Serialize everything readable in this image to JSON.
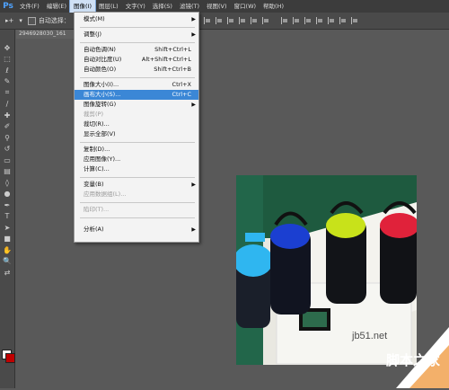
{
  "menubar": {
    "logo": "Ps",
    "items": [
      {
        "label": "文件(F)"
      },
      {
        "label": "编辑(E)"
      },
      {
        "label": "图像(I)"
      },
      {
        "label": "图层(L)"
      },
      {
        "label": "文字(Y)"
      },
      {
        "label": "选择(S)"
      },
      {
        "label": "滤镜(T)"
      },
      {
        "label": "视图(V)"
      },
      {
        "label": "窗口(W)"
      },
      {
        "label": "帮助(H)"
      }
    ],
    "active_index": 2
  },
  "optionsbar": {
    "auto_select_label": "自动选择："
  },
  "document": {
    "tab_title": "2946928030_161"
  },
  "image_menu": {
    "items": [
      {
        "label": "模式(M)",
        "shortcut": "",
        "submenu": true,
        "disabled": false
      },
      {
        "label": "调整(J)",
        "shortcut": "",
        "submenu": true,
        "disabled": false
      },
      {
        "label": "自动色调(N)",
        "shortcut": "Shift+Ctrl+L",
        "submenu": false,
        "disabled": false
      },
      {
        "label": "自动对比度(U)",
        "shortcut": "Alt+Shift+Ctrl+L",
        "submenu": false,
        "disabled": false
      },
      {
        "label": "自动颜色(O)",
        "shortcut": "Shift+Ctrl+B",
        "submenu": false,
        "disabled": false
      },
      {
        "label": "图像大小(I)...",
        "shortcut": "Ctrl+X",
        "submenu": false,
        "disabled": false
      },
      {
        "label": "画布大小(S)...",
        "shortcut": "Ctrl+C",
        "submenu": false,
        "disabled": false,
        "highlight": true
      },
      {
        "label": "图像旋转(G)",
        "shortcut": "",
        "submenu": true,
        "disabled": false
      },
      {
        "label": "裁剪(P)",
        "shortcut": "",
        "submenu": false,
        "disabled": true
      },
      {
        "label": "裁切(R)...",
        "shortcut": "",
        "submenu": false,
        "disabled": false
      },
      {
        "label": "显示全部(V)",
        "shortcut": "",
        "submenu": false,
        "disabled": false
      },
      {
        "label": "复制(D)...",
        "shortcut": "",
        "submenu": false,
        "disabled": false
      },
      {
        "label": "应用图像(Y)...",
        "shortcut": "",
        "submenu": false,
        "disabled": false
      },
      {
        "label": "计算(C)...",
        "shortcut": "",
        "submenu": false,
        "disabled": false
      },
      {
        "label": "变量(B)",
        "shortcut": "",
        "submenu": true,
        "disabled": false
      },
      {
        "label": "应用数据组(L)...",
        "shortcut": "",
        "submenu": false,
        "disabled": true
      },
      {
        "label": "陷印(T)...",
        "shortcut": "",
        "submenu": false,
        "disabled": true
      },
      {
        "label": "分析(A)",
        "shortcut": "",
        "submenu": true,
        "disabled": false
      }
    ]
  },
  "watermark": {
    "domain": "jb51.net",
    "text": "脚本之家"
  },
  "colors": {
    "accent": "#3b87d6",
    "workspace": "#595959",
    "foreground_swatch": "#ffffff",
    "background_swatch": "#c00000"
  },
  "toolbar": {
    "icons": [
      "move-icon",
      "marquee-icon",
      "lasso-icon",
      "quick-select-icon",
      "crop-icon",
      "eyedropper-icon",
      "healing-icon",
      "brush-icon",
      "clone-stamp-icon",
      "history-brush-icon",
      "eraser-icon",
      "gradient-icon",
      "blur-icon",
      "dodge-icon",
      "pen-icon",
      "type-icon",
      "path-select-icon",
      "shape-icon",
      "hand-icon",
      "zoom-icon"
    ]
  }
}
